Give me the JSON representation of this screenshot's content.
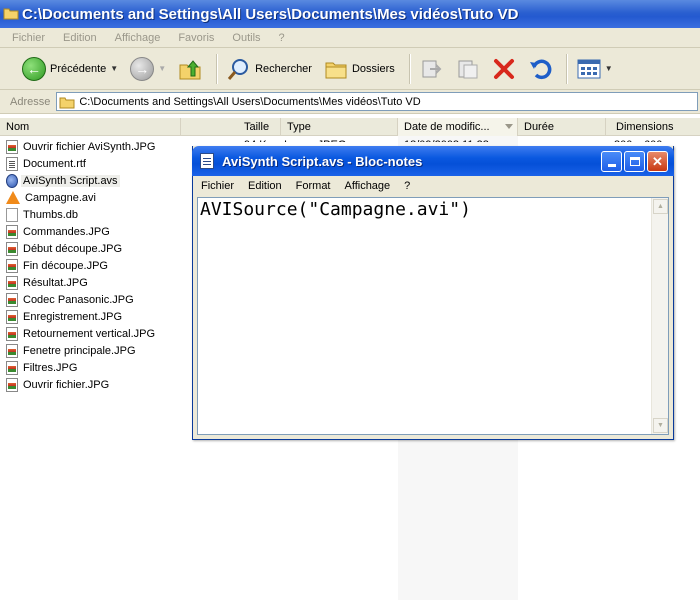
{
  "explorer": {
    "title": "C:\\Documents and Settings\\All Users\\Documents\\Mes vidéos\\Tuto VD",
    "menu": [
      "Fichier",
      "Edition",
      "Affichage",
      "Favoris",
      "Outils",
      "?"
    ],
    "toolbar": {
      "back_label": "Précédente",
      "search_label": "Rechercher",
      "folders_label": "Dossiers"
    },
    "address": {
      "label": "Adresse",
      "value": "C:\\Documents and Settings\\All Users\\Documents\\Mes vidéos\\Tuto VD"
    },
    "columns": [
      "Nom",
      "Taille",
      "Type",
      "Date de modific...",
      "Durée",
      "Dimensions"
    ],
    "partial_row": {
      "size": "94 Ko",
      "type": "Image JPEG",
      "date": "18/09/2008 11:38",
      "dimensions": "800 x 600"
    },
    "files": [
      {
        "name": "Ouvrir fichier AviSynth.JPG",
        "icon": "jpg-icon"
      },
      {
        "name": "Document.rtf",
        "icon": "document-icon"
      },
      {
        "name": "AviSynth Script.avs",
        "icon": "avs-icon",
        "selected": true
      },
      {
        "name": "Campagne.avi",
        "icon": "vlc-cone-icon"
      },
      {
        "name": "Thumbs.db",
        "icon": "db-icon"
      },
      {
        "name": "Commandes.JPG",
        "icon": "jpg-icon"
      },
      {
        "name": "Début découpe.JPG",
        "icon": "jpg-icon"
      },
      {
        "name": "Fin découpe.JPG",
        "icon": "jpg-icon"
      },
      {
        "name": "Résultat.JPG",
        "icon": "jpg-icon"
      },
      {
        "name": "Codec Panasonic.JPG",
        "icon": "jpg-icon"
      },
      {
        "name": "Enregistrement.JPG",
        "icon": "jpg-icon"
      },
      {
        "name": "Retournement vertical.JPG",
        "icon": "jpg-icon"
      },
      {
        "name": "Fenetre principale.JPG",
        "icon": "jpg-icon"
      },
      {
        "name": "Filtres.JPG",
        "icon": "jpg-icon"
      },
      {
        "name": "Ouvrir fichier.JPG",
        "icon": "jpg-icon"
      }
    ]
  },
  "notepad": {
    "title": "AviSynth Script.avs - Bloc-notes",
    "menu": [
      "Fichier",
      "Edition",
      "Format",
      "Affichage",
      "?"
    ],
    "content": "AVISource(\"Campagne.avi\")"
  },
  "colors": {
    "xp_blue": "#0550d8",
    "window_bg": "#ece9d8",
    "close_red": "#c83a14"
  }
}
